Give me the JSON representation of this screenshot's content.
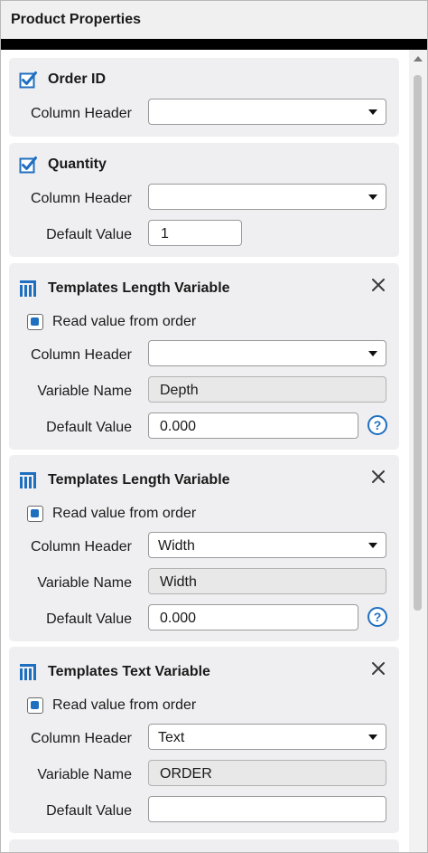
{
  "panel": {
    "title": "Product Properties"
  },
  "order_id": {
    "title": "Order ID",
    "checked": true,
    "column_header_label": "Column Header",
    "column_header_value": ""
  },
  "quantity": {
    "title": "Quantity",
    "checked": true,
    "column_header_label": "Column Header",
    "column_header_value": "",
    "default_value_label": "Default Value",
    "default_value": "1"
  },
  "variables": [
    {
      "title": "Templates Length Variable",
      "read_from_order_label": "Read value from order",
      "read_from_order": true,
      "column_header_label": "Column Header",
      "column_header_value": "",
      "variable_name_label": "Variable Name",
      "variable_name": "Depth",
      "default_value_label": "Default Value",
      "default_value": "0.000"
    },
    {
      "title": "Templates Length Variable",
      "read_from_order_label": "Read value from order",
      "read_from_order": true,
      "column_header_label": "Column Header",
      "column_header_value": "Width",
      "variable_name_label": "Variable Name",
      "variable_name": "Width",
      "default_value_label": "Default Value",
      "default_value": "0.000"
    },
    {
      "title": "Templates Text Variable",
      "read_from_order_label": "Read value from order",
      "read_from_order": true,
      "column_header_label": "Column Header",
      "column_header_value": "Text",
      "variable_name_label": "Variable Name",
      "variable_name": "ORDER",
      "default_value_label": "Default Value",
      "default_value": ""
    }
  ],
  "colors": {
    "accent": "#1f6fc0",
    "card_background": "#efeff1",
    "header_background": "#f0f0f0"
  },
  "icons": {
    "checkbox": "checkbox-checked-icon",
    "variable": "template-variable-icon",
    "close": "close-icon",
    "help": "help-icon",
    "dropdown": "chevron-down-icon"
  }
}
